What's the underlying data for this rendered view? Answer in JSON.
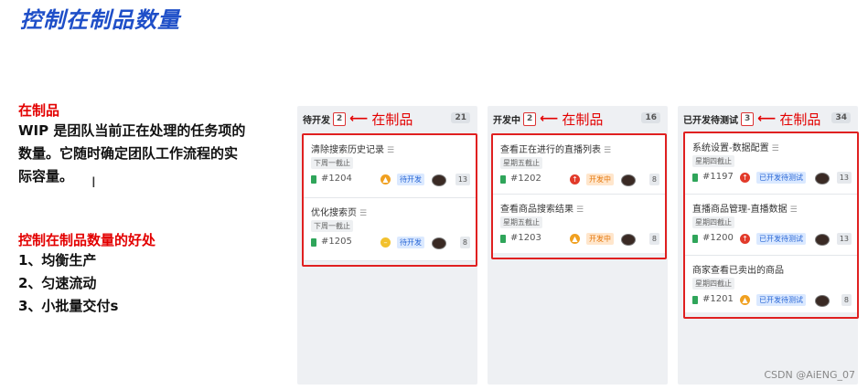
{
  "title": "控制在制品数量",
  "intro": {
    "heading": "在制品",
    "lines": [
      "WIP 是团队当前正在处理的任务项的",
      "数量。它随时确定团队工作流程的实",
      "际容量。"
    ]
  },
  "cursor": "I",
  "benefits": {
    "heading": "控制在制品数量的好处",
    "items": [
      "1、均衡生产",
      "2、匀速流动",
      "3、小批量交付s"
    ]
  },
  "annotation_label": "在制品",
  "arrow_glyph": "⟵",
  "columns": [
    {
      "name": "待开发",
      "wip": "2",
      "total": "21",
      "cards": [
        {
          "title": "清除搜索历史记录",
          "tag": "下周一截止",
          "id": "#1204",
          "priority_color": "#f0a020",
          "priority_glyph": "▲",
          "status": "待开发",
          "status_style": "blue",
          "count": "13"
        },
        {
          "title": "优化搜索页",
          "tag": "下周一截止",
          "id": "#1205",
          "priority_color": "#f2c12e",
          "priority_glyph": "–",
          "status": "待开发",
          "status_style": "blue",
          "count": "8"
        }
      ]
    },
    {
      "name": "开发中",
      "wip": "2",
      "total": "16",
      "cards": [
        {
          "title": "查看正在进行的直播列表",
          "tag": "星期五截止",
          "id": "#1202",
          "priority_color": "#e23a2a",
          "priority_glyph": "↑",
          "status": "开发中",
          "status_style": "orange",
          "count": "8"
        },
        {
          "title": "查看商品搜索结果",
          "tag": "星期五截止",
          "id": "#1203",
          "priority_color": "#f0a020",
          "priority_glyph": "▲",
          "status": "开发中",
          "status_style": "orange",
          "count": "8"
        }
      ]
    },
    {
      "name": "已开发待测试",
      "wip": "3",
      "total": "34",
      "cards": [
        {
          "title": "系统设置-数据配置",
          "tag": "星期四截止",
          "id": "#1197",
          "priority_color": "#e23a2a",
          "priority_glyph": "↑",
          "status": "已开发待测试",
          "status_style": "blue",
          "count": "13"
        },
        {
          "title": "直播商品管理-直播数据",
          "tag": "星期四截止",
          "id": "#1200",
          "priority_color": "#e23a2a",
          "priority_glyph": "↑",
          "status": "已开发待测试",
          "status_style": "blue",
          "count": "13"
        },
        {
          "title": "商家查看已卖出的商品",
          "tag": "星期四截止",
          "id": "#1201",
          "priority_color": "#f0a020",
          "priority_glyph": "▲",
          "status": "已开发待测试",
          "status_style": "blue",
          "count": "8"
        }
      ]
    }
  ],
  "watermark": "CSDN @AiENG_07"
}
